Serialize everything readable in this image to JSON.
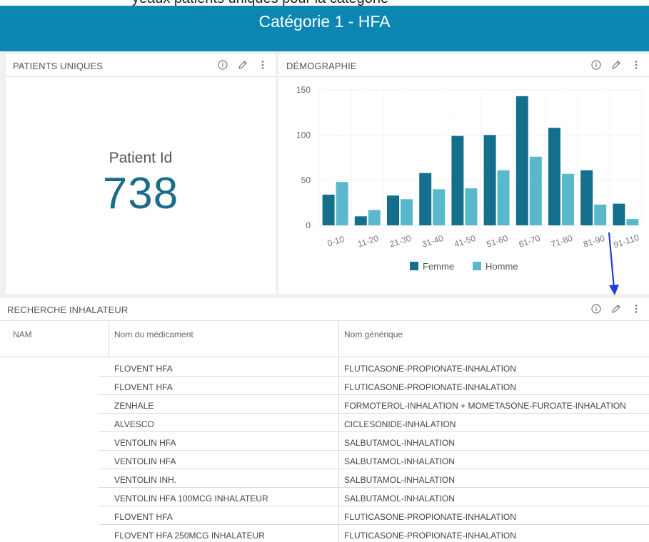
{
  "header": {
    "title": "Catégorie 1 - HFA",
    "cut_text": "yeaux patients uniques pour la catégorie"
  },
  "widgets": {
    "patients": {
      "title": "PATIENTS UNIQUES",
      "kpi_label": "Patient Id",
      "kpi_value": "738"
    },
    "demo": {
      "title": "DÉMOGRAPHIE"
    },
    "search": {
      "title": "RECHERCHE INHALATEUR"
    }
  },
  "chart_data": {
    "type": "bar",
    "categories": [
      "0-10",
      "11-20",
      "21-30",
      "31-40",
      "41-50",
      "51-60",
      "61-70",
      "71-80",
      "81-90",
      "91-110"
    ],
    "series": [
      {
        "name": "Femme",
        "color": "#146f8d",
        "values": [
          34,
          10,
          33,
          58,
          99,
          100,
          143,
          108,
          61,
          24
        ]
      },
      {
        "name": "Homme",
        "color": "#5ab8cc",
        "values": [
          48,
          17,
          29,
          40,
          41,
          61,
          76,
          57,
          23,
          7
        ]
      }
    ],
    "yticks": [
      0,
      50,
      100,
      150
    ],
    "ylim": [
      0,
      150
    ],
    "grid": true,
    "legend": "bottom"
  },
  "table": {
    "columns": [
      "NAM",
      "Nom du médicament",
      "Nom générique"
    ],
    "rows": [
      [
        "FLOVENT HFA",
        "FLUTICASONE-PROPIONATE-INHALATION"
      ],
      [
        "FLOVENT HFA",
        "FLUTICASONE-PROPIONATE-INHALATION"
      ],
      [
        "ZENHALE",
        "FORMOTEROL-INHALATION + MOMETASONE-FUROATE-INHALATION"
      ],
      [
        "ALVESCO",
        "CICLESONIDE-INHALATION"
      ],
      [
        "VENTOLIN HFA",
        "SALBUTAMOL-INHALATION"
      ],
      [
        "VENTOLIN HFA",
        "SALBUTAMOL-INHALATION"
      ],
      [
        "VENTOLIN INH.",
        "SALBUTAMOL-INHALATION"
      ],
      [
        "VENTOLIN HFA 100MCG INHALATEUR",
        "SALBUTAMOL-INHALATION"
      ],
      [
        "FLOVENT HFA",
        "FLUTICASONE-PROPIONATE-INHALATION"
      ],
      [
        "FLOVENT HFA 250MCG INHALATEUR",
        "FLUTICASONE-PROPIONATE-INHALATION"
      ]
    ]
  },
  "icons": {
    "info": "info-icon",
    "edit": "pencil-icon",
    "more": "more-vertical-icon"
  },
  "colors": {
    "header": "#0c87b3",
    "kpi": "#1b6b8a",
    "annotation_arrow": "#1f3fd6"
  }
}
